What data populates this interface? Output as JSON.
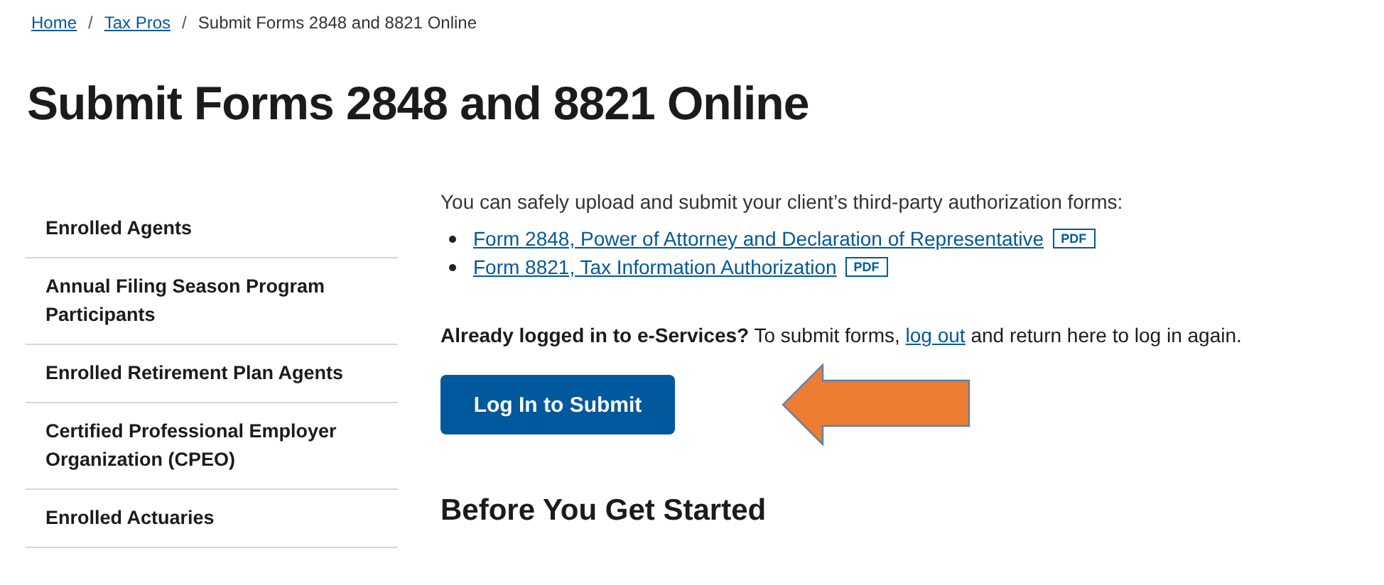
{
  "breadcrumb": [
    {
      "label": "Home",
      "kind": "link"
    },
    {
      "label": "Tax Pros",
      "kind": "link"
    },
    {
      "label": "Submit Forms 2848 and 8821 Online",
      "kind": "current"
    }
  ],
  "breadcrumb_separator": "/",
  "title": "Submit Forms 2848 and 8821 Online",
  "sidebar": {
    "items": [
      {
        "label": "Enrolled Agents"
      },
      {
        "label": "Annual Filing Season Program Participants"
      },
      {
        "label": "Enrolled Retirement Plan Agents"
      },
      {
        "label": "Certified Professional Employer Organization (CPEO)"
      },
      {
        "label": "Enrolled Actuaries"
      }
    ]
  },
  "intro": "You can safely upload and submit your client’s third-party authorization forms:",
  "forms": [
    {
      "label": "Form 2848, Power of Attorney and Declaration of Representative",
      "badge": "PDF"
    },
    {
      "label": "Form 8821, Tax Information Authorization",
      "badge": "PDF"
    }
  ],
  "notice": {
    "before": "**Already logged in to e-Services?** To submit forms, ",
    "link": "log out",
    "after": " and return here to log in again."
  },
  "button": "Log In to Submit",
  "section_heading": "Before You Get Started"
}
